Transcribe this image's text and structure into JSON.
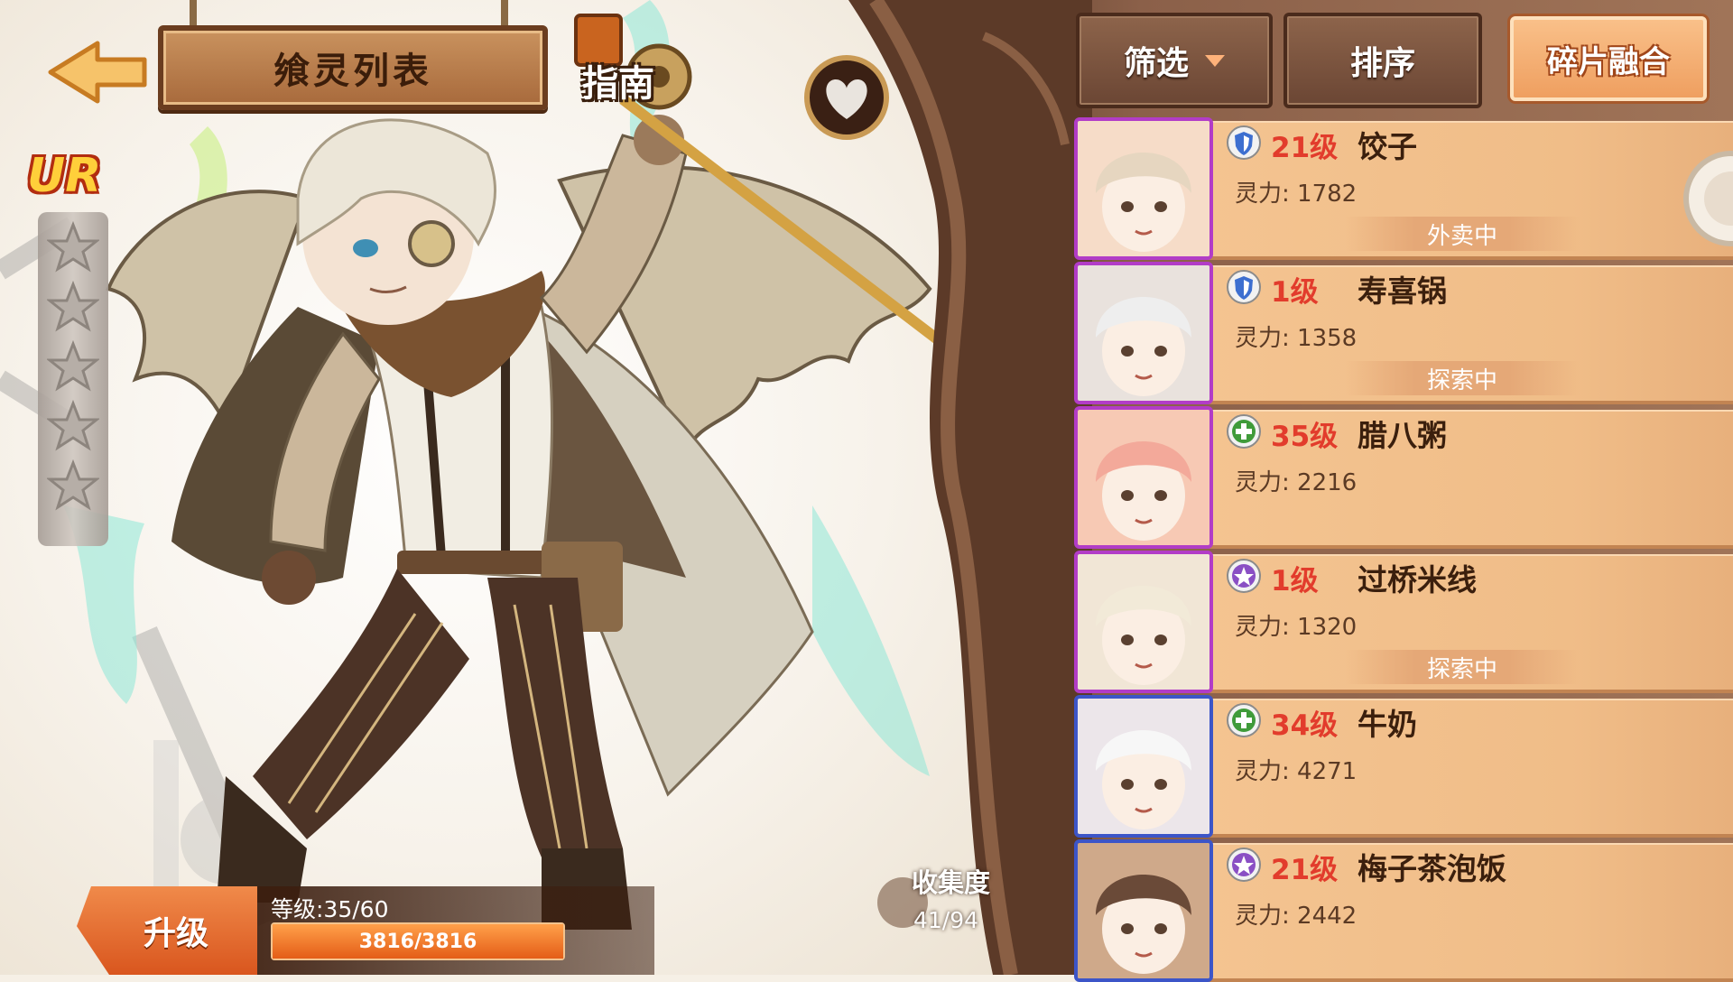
{
  "header": {
    "back_label": "",
    "title": "飨灵列表",
    "guide_label": "指南"
  },
  "hero": {
    "rarity": "UR",
    "star_count": 5,
    "upgrade_label": "升级",
    "level_text": "等级:35/60",
    "exp_text": "3816/3816",
    "exp_fraction": 1.0
  },
  "collection": {
    "title": "收集度",
    "value": "41/94"
  },
  "toolbar": {
    "filter_label": "筛选",
    "sort_label": "排序",
    "fuse_label": "碎片融合"
  },
  "colors": {
    "purple_frame": "#b23cc7",
    "blue_frame": "#3c55c8",
    "shield": "#3d6fd0",
    "heal": "#3f9b3a",
    "magic": "#8a4fc4",
    "level_red": "#e23c2c"
  },
  "characters": [
    {
      "level": "21级",
      "name": "饺子",
      "power": "灵力: 1782",
      "status": "外卖中",
      "type": "shield-icon",
      "frame": "purple"
    },
    {
      "level": "1级",
      "name": "寿喜锅",
      "power": "灵力: 1358",
      "status": "探索中",
      "type": "shield-icon",
      "frame": "purple"
    },
    {
      "level": "35级",
      "name": "腊八粥",
      "power": "灵力: 2216",
      "status": "",
      "type": "heal-icon",
      "frame": "purple"
    },
    {
      "level": "1级",
      "name": "过桥米线",
      "power": "灵力: 1320",
      "status": "探索中",
      "type": "magic-icon",
      "frame": "purple"
    },
    {
      "level": "34级",
      "name": "牛奶",
      "power": "灵力: 4271",
      "status": "",
      "type": "heal-icon",
      "frame": "blue"
    },
    {
      "level": "21级",
      "name": "梅子茶泡饭",
      "power": "灵力: 2442",
      "status": "",
      "type": "magic-icon",
      "frame": "blue"
    }
  ]
}
